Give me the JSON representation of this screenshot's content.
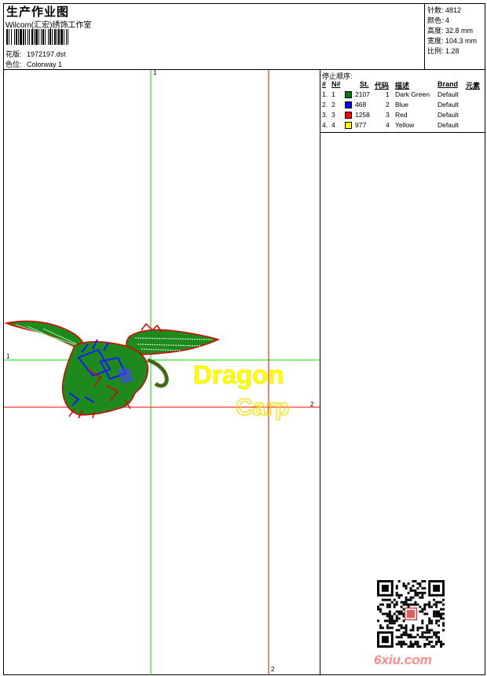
{
  "header": {
    "title": "生产作业图",
    "studio": "Wilcom(汇宏)绣饰工作室",
    "design_label": "花版:",
    "design_value": "1972197.dst",
    "color_label": "色位:",
    "color_value": "Colorway 1"
  },
  "stats": [
    {
      "label": "针数:",
      "value": "4812"
    },
    {
      "label": "颜色:",
      "value": "4"
    },
    {
      "label": "高度:",
      "value": "32.8 mm"
    },
    {
      "label": "宽度:",
      "value": "104.3 mm"
    },
    {
      "label": "比例:",
      "value": "1.28"
    }
  ],
  "stop_sequence": {
    "title": "停止顺序:",
    "headers": {
      "stop": "#",
      "no": "N#",
      "st": "St.",
      "code": "代码",
      "desc": "描述",
      "brand": "Brand",
      "elem": "元素"
    },
    "rows": [
      {
        "stop": "1.",
        "no": "1",
        "color": "#008000",
        "st": "2107",
        "code": "1",
        "desc": "Dark Green",
        "brand": "Default"
      },
      {
        "stop": "2.",
        "no": "2",
        "color": "#0000ff",
        "st": "468",
        "code": "2",
        "desc": "Blue",
        "brand": "Default"
      },
      {
        "stop": "3.",
        "no": "3",
        "color": "#ff0000",
        "st": "1258",
        "code": "3",
        "desc": "Red",
        "brand": "Default"
      },
      {
        "stop": "4.",
        "no": "4",
        "color": "#ffff00",
        "st": "977",
        "code": "4",
        "desc": "Yellow",
        "brand": "Default"
      }
    ]
  },
  "design": {
    "word1": "Dragon",
    "word2": "Carp",
    "colors": {
      "green": "#008000",
      "blue": "#1a1aff",
      "red": "#dd0000",
      "yellow": "#ffff00",
      "guide_green": "#00dd00",
      "guide_red": "#ff0000"
    }
  },
  "guides": {
    "green_v": "1",
    "green_h": "1",
    "red_h": "2",
    "red_v": "2"
  },
  "watermark": "6xiu.com"
}
